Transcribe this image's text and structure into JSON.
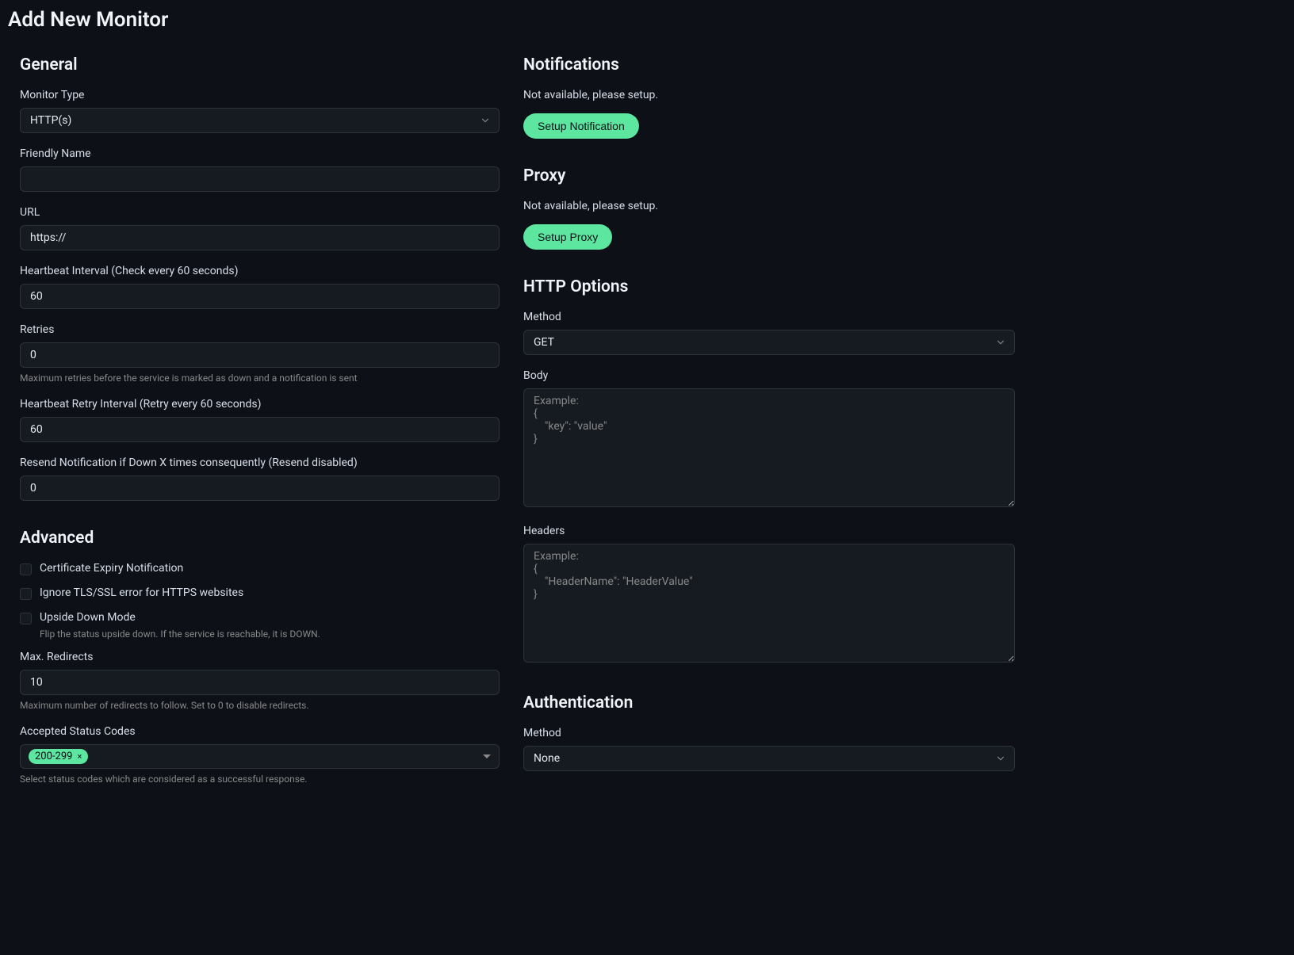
{
  "page_title": "Add New Monitor",
  "general": {
    "heading": "General",
    "monitor_type": {
      "label": "Monitor Type",
      "value": "HTTP(s)"
    },
    "friendly_name": {
      "label": "Friendly Name",
      "value": ""
    },
    "url": {
      "label": "URL",
      "value": "https://"
    },
    "heartbeat_interval": {
      "label": "Heartbeat Interval (Check every 60 seconds)",
      "value": "60"
    },
    "retries": {
      "label": "Retries",
      "value": "0",
      "help": "Maximum retries before the service is marked as down and a notification is sent"
    },
    "heartbeat_retry_interval": {
      "label": "Heartbeat Retry Interval (Retry every 60 seconds)",
      "value": "60"
    },
    "resend_notification": {
      "label": "Resend Notification if Down X times consequently (Resend disabled)",
      "value": "0"
    }
  },
  "advanced": {
    "heading": "Advanced",
    "cert_expiry": {
      "label": "Certificate Expiry Notification"
    },
    "ignore_tls": {
      "label": "Ignore TLS/SSL error for HTTPS websites"
    },
    "upside_down": {
      "label": "Upside Down Mode",
      "help": "Flip the status upside down. If the service is reachable, it is DOWN."
    },
    "max_redirects": {
      "label": "Max. Redirects",
      "value": "10",
      "help": "Maximum number of redirects to follow. Set to 0 to disable redirects."
    },
    "accepted_status": {
      "label": "Accepted Status Codes",
      "tag": "200-299",
      "help": "Select status codes which are considered as a successful response."
    }
  },
  "notifications": {
    "heading": "Notifications",
    "status": "Not available, please setup.",
    "button": "Setup Notification"
  },
  "proxy": {
    "heading": "Proxy",
    "status": "Not available, please setup.",
    "button": "Setup Proxy"
  },
  "http_options": {
    "heading": "HTTP Options",
    "method": {
      "label": "Method",
      "value": "GET"
    },
    "body": {
      "label": "Body",
      "placeholder": "Example:\n{\n    \"key\": \"value\"\n}"
    },
    "headers": {
      "label": "Headers",
      "placeholder": "Example:\n{\n    \"HeaderName\": \"HeaderValue\"\n}"
    }
  },
  "authentication": {
    "heading": "Authentication",
    "method": {
      "label": "Method",
      "value": "None"
    }
  }
}
